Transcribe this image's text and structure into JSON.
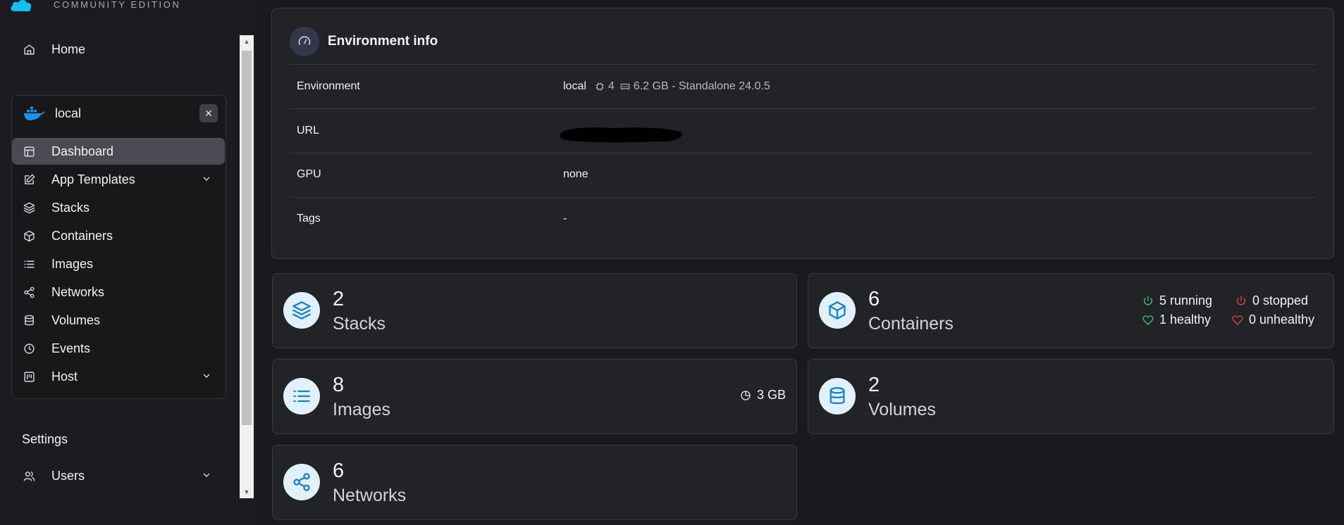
{
  "brand": {
    "edition": "COMMUNITY EDITION"
  },
  "sidebar": {
    "home_label": "Home",
    "environment": {
      "name": "local",
      "close_glyph": "✕",
      "items": [
        {
          "label": "Dashboard",
          "icon": "dashboard-icon",
          "active": true
        },
        {
          "label": "App Templates",
          "icon": "edit-icon",
          "expandable": true
        },
        {
          "label": "Stacks",
          "icon": "layers-icon"
        },
        {
          "label": "Containers",
          "icon": "box-icon"
        },
        {
          "label": "Images",
          "icon": "list-icon"
        },
        {
          "label": "Networks",
          "icon": "share-icon"
        },
        {
          "label": "Volumes",
          "icon": "database-icon"
        },
        {
          "label": "Events",
          "icon": "clock-icon"
        },
        {
          "label": "Host",
          "icon": "host-icon",
          "expandable": true
        }
      ]
    },
    "settings_label": "Settings",
    "users_label": "Users"
  },
  "env_info": {
    "title": "Environment info",
    "rows": {
      "environment_label": "Environment",
      "environment_name": "local",
      "cpu": "4",
      "memory_version": "6.2 GB - Standalone 24.0.5",
      "url_label": "URL",
      "gpu_label": "GPU",
      "gpu_value": "none",
      "tags_label": "Tags",
      "tags_value": "-"
    }
  },
  "stats": {
    "stacks": {
      "count": "2",
      "label": "Stacks"
    },
    "containers": {
      "count": "6",
      "label": "Containers",
      "running": "5 running",
      "stopped": "0 stopped",
      "healthy": "1 healthy",
      "unhealthy": "0 unhealthy"
    },
    "images": {
      "count": "8",
      "label": "Images",
      "size": "3 GB"
    },
    "volumes": {
      "count": "2",
      "label": "Volumes"
    },
    "networks": {
      "count": "6",
      "label": "Networks"
    }
  },
  "colors": {
    "accent_icon": "#1583c7",
    "running": "#3cc47c",
    "stopped": "#e04444"
  }
}
